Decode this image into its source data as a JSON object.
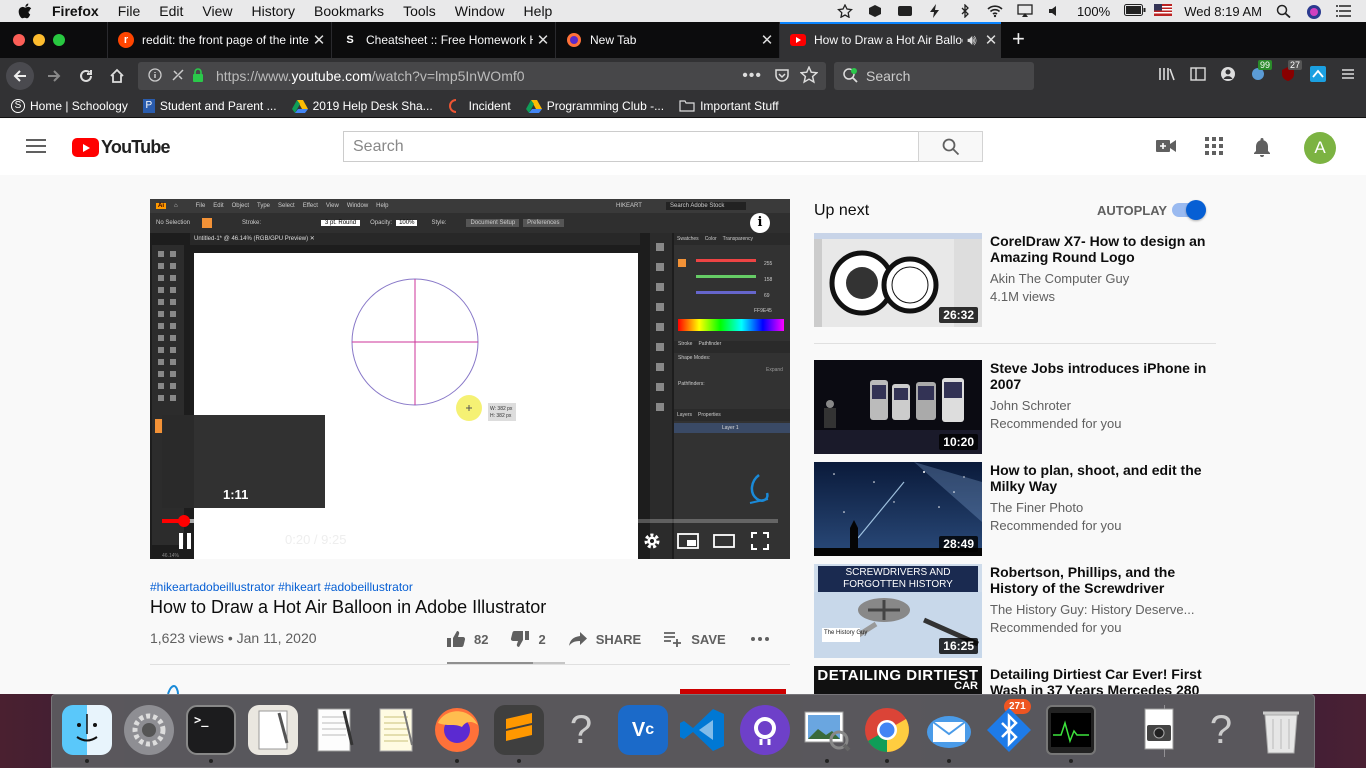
{
  "menubar": {
    "items": [
      "Firefox",
      "File",
      "Edit",
      "View",
      "History",
      "Bookmarks",
      "Tools",
      "Window",
      "Help"
    ],
    "battery": "100%",
    "clock": "Wed 8:19 AM"
  },
  "tabs": [
    {
      "title": "reddit: the front page of the inte",
      "favicon": "reddit-icon"
    },
    {
      "title": "Cheatsheet :: Free Homework H",
      "favicon": "s-icon"
    },
    {
      "title": "New Tab",
      "favicon": "firefox-icon"
    },
    {
      "title": "How to Draw a Hot Air Balloo",
      "favicon": "youtube-icon"
    }
  ],
  "navbar": {
    "url_prefix": "https://www.",
    "url_domain": "youtube.com",
    "url_path": "/watch?v=lmp5InWOmf0",
    "search_placeholder": "Search",
    "badge_1": "99",
    "badge_2": "27"
  },
  "bookmarks": [
    {
      "label": "Home | Schoology",
      "icon": "schoology-icon"
    },
    {
      "label": "Student and Parent ...",
      "icon": "p-icon"
    },
    {
      "label": "2019 Help Desk Sha...",
      "icon": "drive-icon"
    },
    {
      "label": "Incident",
      "icon": "incident-icon"
    },
    {
      "label": "Programming Club -...",
      "icon": "drive-icon"
    },
    {
      "label": "Important Stuff",
      "icon": "folder-icon"
    }
  ],
  "youtube": {
    "logo_text": "YouTube",
    "search_placeholder": "Search",
    "avatar_letter": "A"
  },
  "player": {
    "preview_time": "1:11",
    "time": "0:20 / 9:25",
    "progress_fraction": 0.036,
    "buffer_fraction": 0.13,
    "app_menu": [
      "File",
      "Edit",
      "Object",
      "Type",
      "Select",
      "Effect",
      "View",
      "Window",
      "Help"
    ],
    "doc_tab": "Untitled-1* @ 46.14% (RGB/GPU Preview)",
    "workspace": "HIKEART",
    "selection_label": "No Selection",
    "stroke_label": "Stroke:",
    "brush_label": "3 pt. Round",
    "opacity_label": "Opacity:",
    "opacity_value": "100%",
    "style_label": "Style:",
    "doc_setup_button": "Document Setup",
    "preferences_button": "Preferences",
    "stock_search_placeholder": "Search Adobe Stock",
    "measure_w": "W: 382 px",
    "measure_h": "H: 382 px",
    "panel_tabs": [
      "Swatches",
      "Color",
      "Transparency"
    ],
    "color_values": [
      "255",
      "158",
      "69"
    ],
    "hex_value": "FF9E45",
    "stroke_tab": "Stroke",
    "pathfinder_tab": "Pathfinder",
    "shape_modes_label": "Shape Modes:",
    "pathfinders_label": "Pathfinders:",
    "expand_button": "Expand",
    "layers_tab": "Layers",
    "properties_tab": "Properties",
    "layer_name": "Layer 1",
    "zoom_value": "46.14%"
  },
  "video": {
    "hashtags": "#hikeartadobeillustrator #hikeart #adobeillustrator",
    "title": "How to Draw a Hot Air Balloon in Adobe Illustrator",
    "stats": "1,623 views • Jan 11, 2020",
    "likes": "82",
    "dislikes": "2",
    "share": "SHARE",
    "save": "SAVE"
  },
  "upnext": {
    "heading": "Up next",
    "autoplay": "AUTOPLAY",
    "autoplay_on": true,
    "items": [
      {
        "title": "CorelDraw X7- How to design an Amazing Round Logo",
        "channel": "Akin The Computer Guy",
        "meta": "4.1M views",
        "duration": "26:32"
      },
      {
        "title": "Steve Jobs introduces iPhone in 2007",
        "channel": "John Schroter",
        "meta": "Recommended for you",
        "duration": "10:20"
      },
      {
        "title": "How to plan, shoot, and edit the Milky Way",
        "channel": "The Finer Photo",
        "meta": "Recommended for you",
        "duration": "28:49"
      },
      {
        "title": "Robertson, Phillips, and the History of the Screwdriver",
        "channel": "The History Guy: History Deserve...",
        "meta": "Recommended for you",
        "duration": "16:25"
      },
      {
        "title": "Detailing Dirtiest Car Ever! First Wash in 37 Years Mercedes 280",
        "channel": "",
        "meta": "",
        "duration": ""
      }
    ],
    "thumb_texts": {
      "screwdriver": "SCREWDRIVERS AND FORGOTTEN HISTORY",
      "history_guy": "The History Guy",
      "detailing": "DETAILING DIRTIEST",
      "car": "CAR"
    }
  },
  "dock": {
    "mail_badge": "271",
    "apps": [
      "finder-icon",
      "system-preferences-icon",
      "terminal-icon",
      "script-editor-icon",
      "textedit-icon",
      "notes-icon",
      "firefox-icon",
      "sublime-text-icon",
      "unknown-app-icon",
      "vnc-viewer-icon",
      "vscode-icon",
      "github-desktop-icon",
      "preview-icon",
      "chrome-icon",
      "mail-icon",
      "bluetooth-icon",
      "activity-monitor-icon",
      "screenshot-icon",
      "unknown-app-icon",
      "trash-icon"
    ]
  },
  "colors": {
    "youtube_red": "#ff0000",
    "link_blue": "#065fd4",
    "firefox_blue": "#0a84ff"
  }
}
